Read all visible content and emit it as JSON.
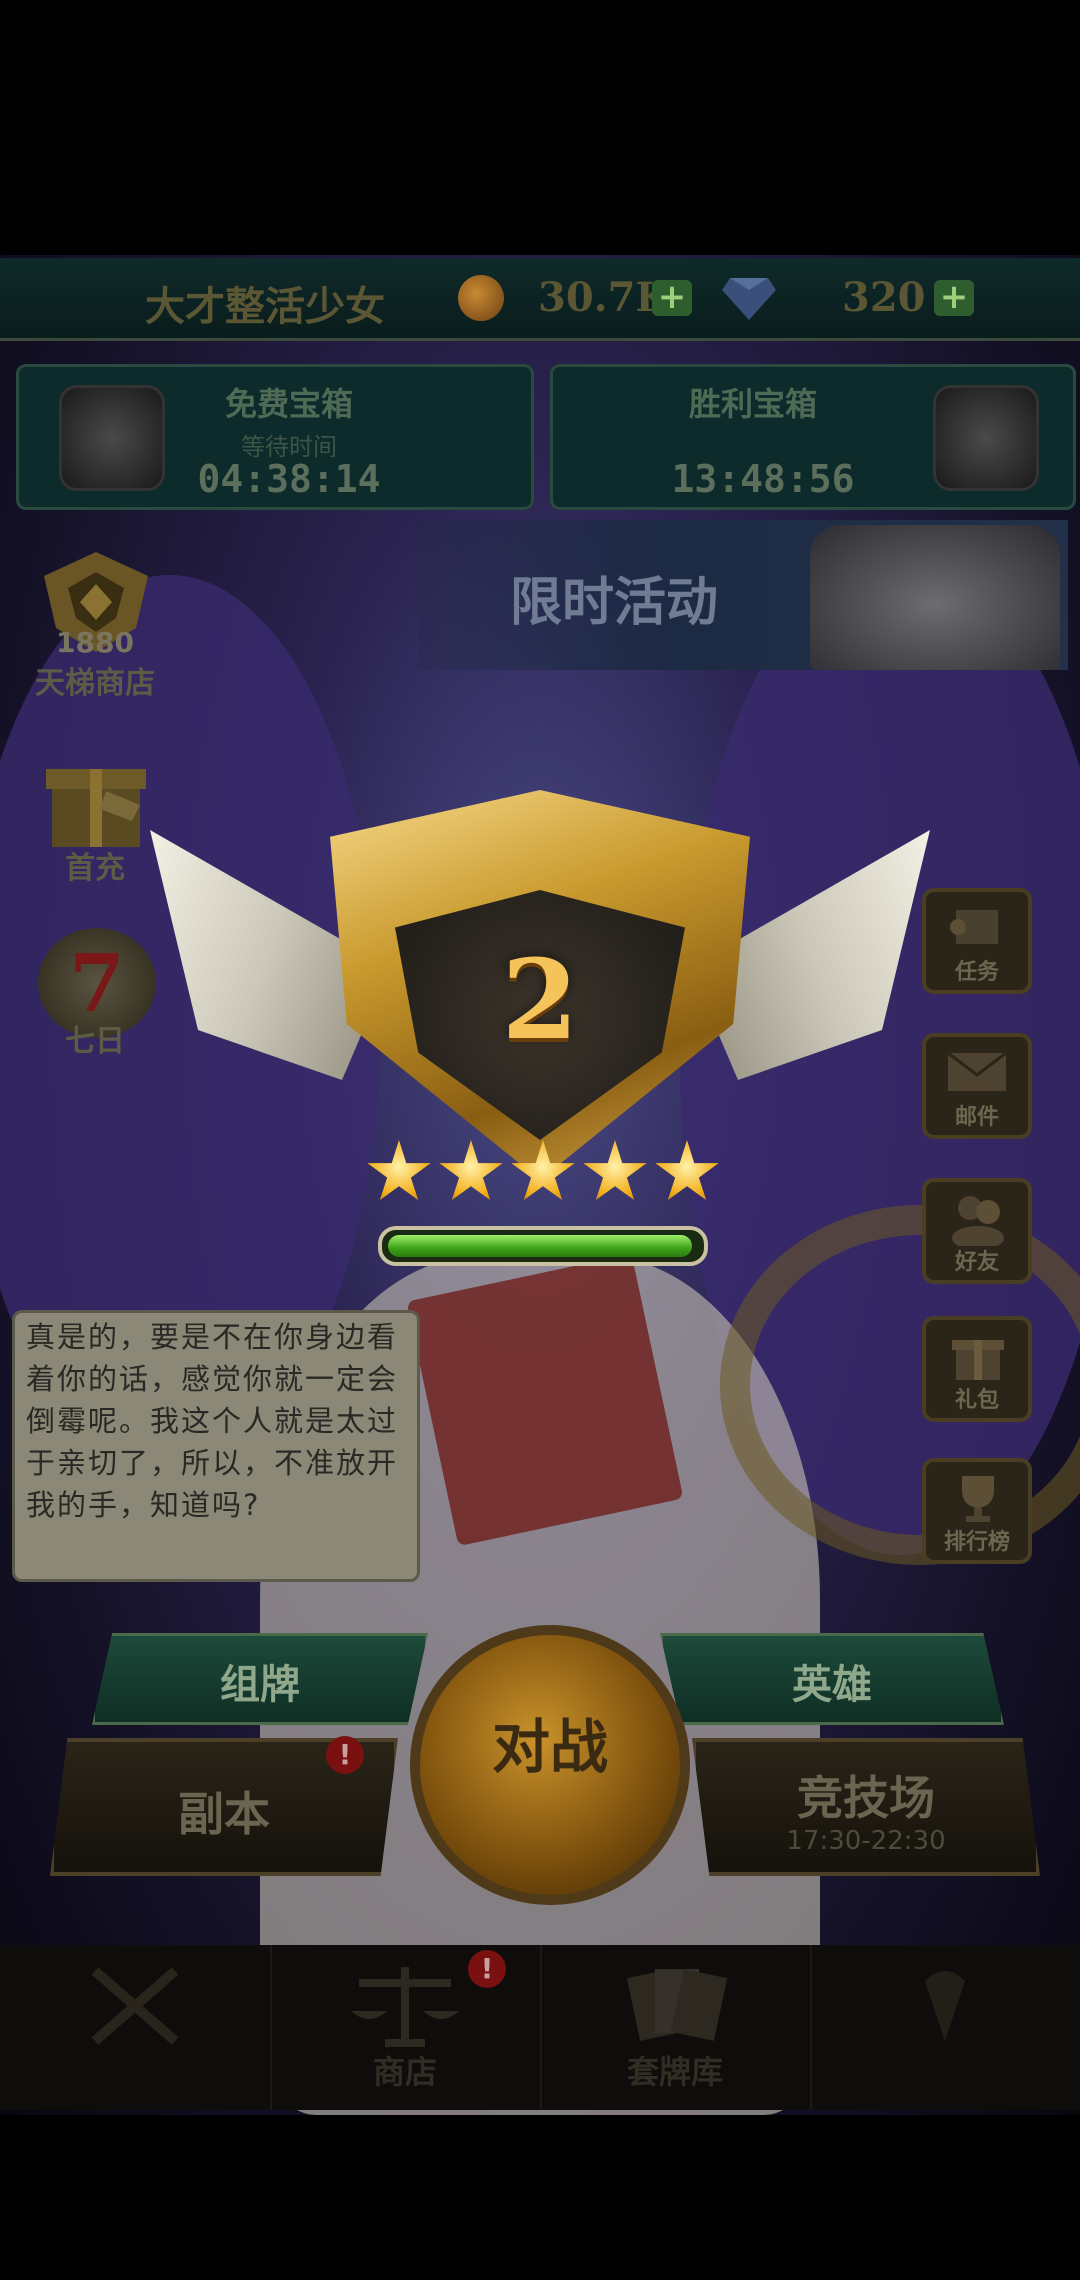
{
  "header": {
    "player_name": "大才整活少女",
    "gold": "30.7K",
    "gems": "320"
  },
  "chests": {
    "free": {
      "title": "免费宝箱",
      "subtitle": "等待时间",
      "timer": "04:38:14"
    },
    "victory": {
      "title": "胜利宝箱",
      "timer": "13:48:56"
    }
  },
  "event_banner": {
    "label": "限时活动"
  },
  "left_menu": {
    "ladder_points": "1880",
    "ladder_shop": "天梯商店",
    "first_recharge": "首充",
    "seven_day": "七日",
    "seven_day_number": "7"
  },
  "right_menu": {
    "tasks": "任务",
    "mail": "邮件",
    "friends": "好友",
    "gifts": "礼包",
    "leaderboard": "排行榜"
  },
  "rank": {
    "level": "2",
    "stars": 5,
    "progress_fraction": 0.98
  },
  "dialogue": {
    "text": "真是的，要是不在你身边看着你的话，感觉你就一定会倒霉呢。我这个人就是太过于亲切了，所以，不准放开我的手，知道吗?"
  },
  "actions": {
    "deck": "组牌",
    "heroes": "英雄",
    "battle": "对战",
    "dungeon": "副本",
    "arena": "竞技场",
    "arena_hours": "17:30-22:30",
    "alert_mark": "!"
  },
  "nav": {
    "shop": "商店",
    "deck_library": "套牌库"
  },
  "colors": {
    "gold_accent": "#f3b01e",
    "progress_green": "#3ea319",
    "alert_red": "#7a1010"
  }
}
